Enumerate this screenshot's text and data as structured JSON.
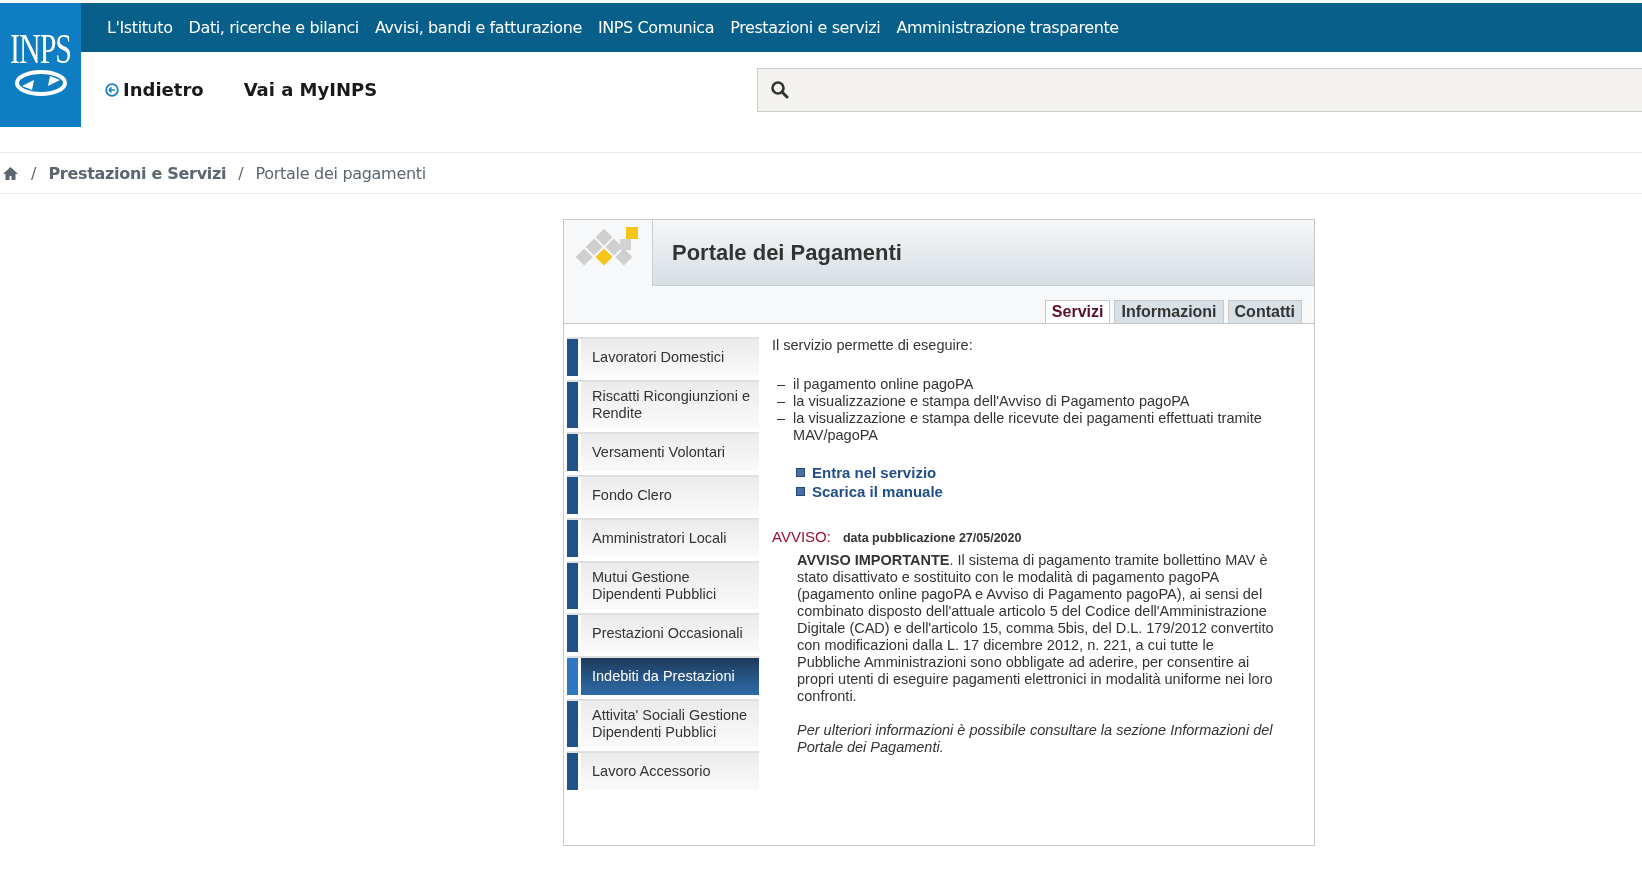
{
  "logo": {
    "text": "INPS"
  },
  "top_nav": [
    {
      "label": "L'Istituto"
    },
    {
      "label": "Dati, ricerche e bilanci"
    },
    {
      "label": "Avvisi, bandi e fatturazione"
    },
    {
      "label": "INPS Comunica"
    },
    {
      "label": "Prestazioni e servizi"
    },
    {
      "label": "Amministrazione trasparente"
    }
  ],
  "back_link": {
    "label": "Indietro"
  },
  "myinps_link": {
    "label": "Vai a MyINPS"
  },
  "breadcrumb": [
    {
      "separator": "/",
      "label": "Prestazioni e Servizi",
      "current": false
    },
    {
      "separator": "/",
      "label": "Portale dei pagamenti",
      "current": true
    }
  ],
  "panel": {
    "title": "Portale dei Pagamenti",
    "tabs": [
      {
        "label": "Servizi",
        "selected": true
      },
      {
        "label": "Informazioni",
        "selected": false
      },
      {
        "label": "Contatti",
        "selected": false
      }
    ],
    "sidebar": [
      {
        "label": "Lavoratori Domestici",
        "selected": false
      },
      {
        "label": "Riscatti Ricongiunzioni e Rendite",
        "selected": false
      },
      {
        "label": "Versamenti Volontari",
        "selected": false
      },
      {
        "label": "Fondo Clero",
        "selected": false
      },
      {
        "label": "Amministratori Locali",
        "selected": false
      },
      {
        "label": "Mutui Gestione Dipendenti Pubblici",
        "selected": false
      },
      {
        "label": "Prestazioni Occasionali",
        "selected": false
      },
      {
        "label": "Indebiti da Prestazioni",
        "selected": true
      },
      {
        "label": "Attivita' Sociali Gestione Dipendenti Pubblici",
        "selected": false
      },
      {
        "label": "Lavoro Accessorio",
        "selected": false
      }
    ],
    "intro": "Il servizio permette di eseguire:",
    "bullets": [
      {
        "dash": "–",
        "text": "il pagamento online pagoPA"
      },
      {
        "dash": "–",
        "text": "la visualizzazione e stampa dell'Avviso di Pagamento pagoPA"
      },
      {
        "dash": "–",
        "text": "la visualizzazione e stampa delle ricevute dei pagamenti effettuati tramite MAV/pagoPA"
      }
    ],
    "links": [
      {
        "label": "Entra nel servizio"
      },
      {
        "label": "Scarica il manuale"
      }
    ],
    "notice": {
      "label": "AVVISO:",
      "date": "data pubblicazione 27/05/2020",
      "body": "**AVVISO IMPORTANTE**. Il sistema di pagamento tramite bollettino MAV è stato disattivato e sostituito con le modalità di pagamento pagoPA (pagamento online pagoPA e Avviso di Pagamento pagoPA), ai sensi del combinato disposto dell'attuale articolo 5 del Codice dell'Amministrazione Digitale (CAD) e dell'articolo 15, comma 5bis, del D.L. 179/2012 convertito con modificazioni dalla L. 17 dicembre 2012, n. 221, a cui tutte le Pubbliche Amministrazioni sono obbligate ad aderire, per consentire ai propri utenti di eseguire pagamenti elettronici in modalità uniforme nei loro confronti.",
      "note": "Per ulteriori informazioni è possibile consultare la sezione Informazioni del Portale dei Pagamenti."
    }
  }
}
